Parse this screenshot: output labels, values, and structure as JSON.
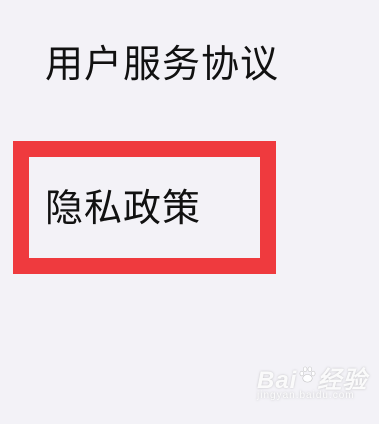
{
  "settings_list": {
    "items": [
      {
        "label": "用户服务协议"
      },
      {
        "label": "隐私政策"
      }
    ],
    "highlighted_item": "隐私政策",
    "highlight_color": "#ef3a3e"
  },
  "watermark": {
    "text_left": "Bai",
    "text_right": "经验",
    "url": "jingyan.baidu.com"
  }
}
